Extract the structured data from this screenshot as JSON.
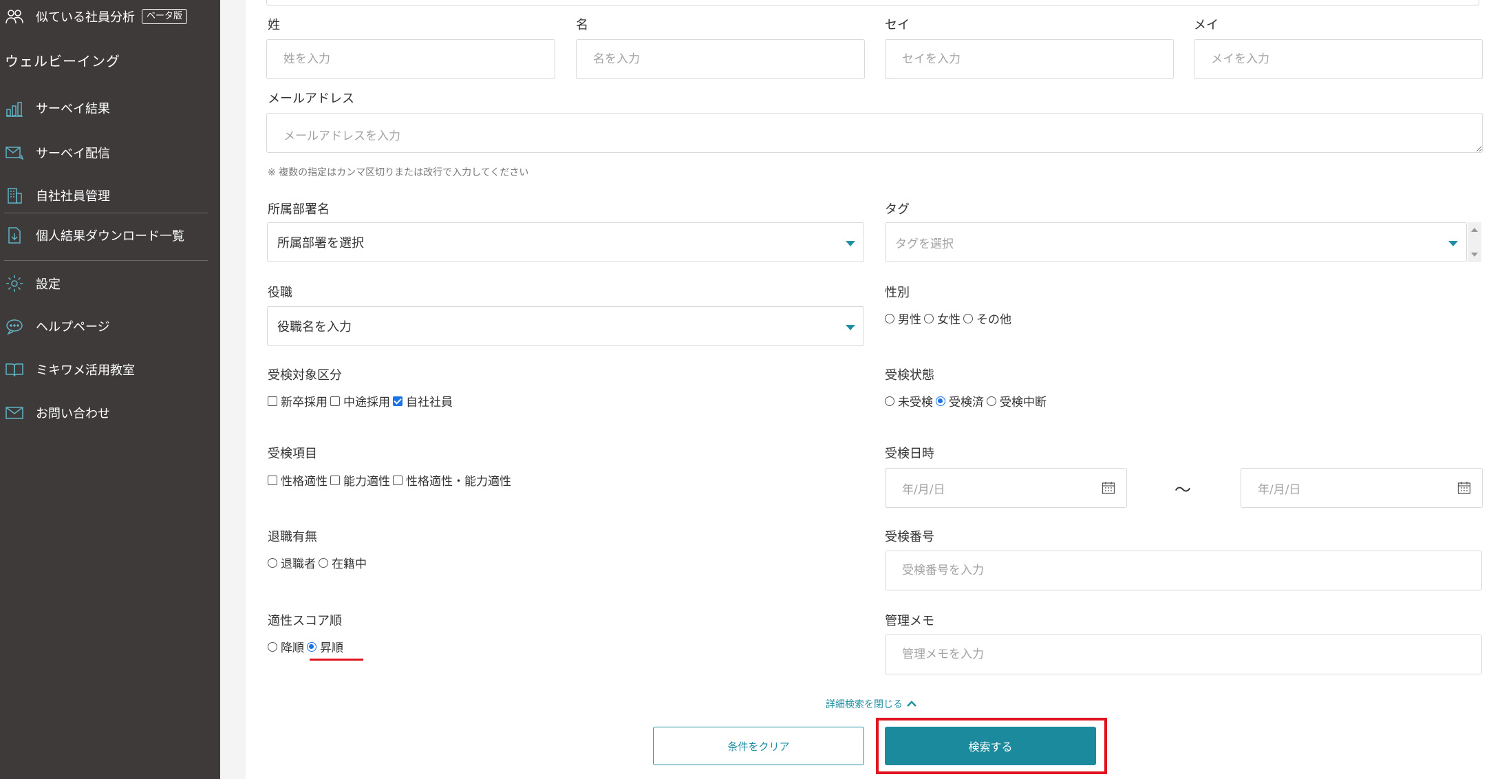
{
  "sidebar": {
    "similar_employees": {
      "label": "似ている社員分析",
      "badge": "ベータ版",
      "icon": "people-analysis-icon"
    },
    "section_wellbeing": "ウェルビーイング",
    "items": [
      {
        "label": "サーベイ結果",
        "icon": "bar-chart-icon"
      },
      {
        "label": "サーベイ配信",
        "icon": "mail-send-icon"
      },
      {
        "label": "自社社員管理",
        "icon": "building-icon"
      },
      {
        "label": "個人結果ダウンロード一覧",
        "icon": "file-download-icon"
      },
      {
        "label": "設定",
        "icon": "gear-icon"
      },
      {
        "label": "ヘルプページ",
        "icon": "chat-bubble-icon"
      },
      {
        "label": "ミキワメ活用教室",
        "icon": "book-icon"
      },
      {
        "label": "お問い合わせ",
        "icon": "envelope-icon"
      }
    ]
  },
  "form": {
    "last_name": {
      "label": "姓",
      "placeholder": "姓を入力"
    },
    "first_name": {
      "label": "名",
      "placeholder": "名を入力"
    },
    "last_kana": {
      "label": "セイ",
      "placeholder": "セイを入力"
    },
    "first_kana": {
      "label": "メイ",
      "placeholder": "メイを入力"
    },
    "email": {
      "label": "メールアドレス",
      "placeholder": "メールアドレスを入力",
      "note": "※ 複数の指定はカンマ区切りまたは改行で入力してください"
    },
    "department": {
      "label": "所属部署名",
      "value": "所属部署を選択"
    },
    "tag": {
      "label": "タグ",
      "placeholder": "タグを選択"
    },
    "position": {
      "label": "役職",
      "value": "役職名を入力"
    },
    "gender": {
      "label": "性別",
      "options": [
        "男性",
        "女性",
        "その他"
      ],
      "selected": null
    },
    "target_type": {
      "label": "受検対象区分",
      "options": [
        "新卒採用",
        "中途採用",
        "自社社員"
      ],
      "checked": [
        false,
        false,
        true
      ]
    },
    "exam_status": {
      "label": "受検状態",
      "options": [
        "未受検",
        "受検済",
        "受検中断"
      ],
      "selected": "受検済"
    },
    "exam_items": {
      "label": "受検項目",
      "options": [
        "性格適性",
        "能力適性",
        "性格適性・能力適性"
      ],
      "checked": [
        false,
        false,
        false
      ]
    },
    "exam_date": {
      "label": "受検日時",
      "from_placeholder": "年/月/日",
      "separator": "〜",
      "to_placeholder": "年/月/日"
    },
    "retired": {
      "label": "退職有無",
      "options": [
        "退職者",
        "在籍中"
      ],
      "selected": null
    },
    "exam_number": {
      "label": "受検番号",
      "placeholder": "受検番号を入力"
    },
    "score_order": {
      "label": "適性スコア順",
      "options": [
        "降順",
        "昇順"
      ],
      "selected": "昇順"
    },
    "memo": {
      "label": "管理メモ",
      "placeholder": "管理メモを入力"
    }
  },
  "actions": {
    "toggle_advanced": "詳細検索を閉じる",
    "clear": "条件をクリア",
    "search": "検索する"
  },
  "colors": {
    "sidebar_bg": "#3e3a39",
    "accent": "#1a8a9c",
    "highlight": "#e0141e",
    "radio_checked": "#1a73e8"
  }
}
